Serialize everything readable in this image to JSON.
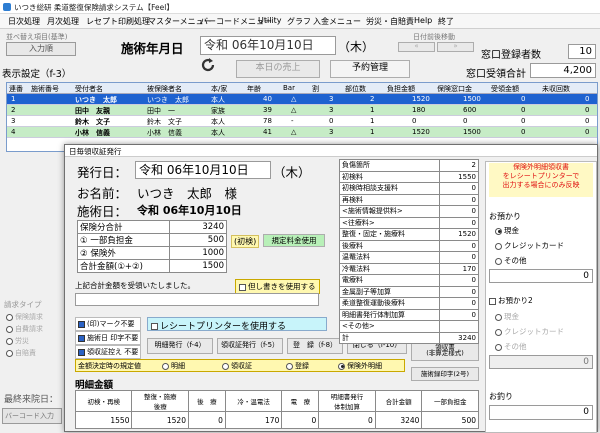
{
  "window": {
    "title": "いつき総研 柔道整復保険請求システム【Feel】"
  },
  "menu": [
    "日次処理",
    "月次処理",
    "レセプト印刷処理",
    "マスターメニュー",
    "バーコードメニュー",
    "Utility",
    "グラフ",
    "入金メニュー",
    "労災・自賠責",
    "Help",
    "終了"
  ],
  "main": {
    "sort_label": "並べ替え項目(基準)",
    "sort_value": "入力順",
    "date_label": "施術年月日",
    "date_value": "令和 06年10月10日",
    "weekday": "（木）",
    "display_setting": "表示設定（f-3）",
    "today_sales": "本日の売上",
    "reservation": "予約管理",
    "day_move_label": "日付前後移動",
    "counter_label": "窓口登録者数",
    "counter_value": "10",
    "window_total_label": "窓口受領合計",
    "window_total_value": "4,200",
    "reception_type_label": "請求タイプ",
    "reception_options": [
      "保険請求",
      "自費請求",
      "労災",
      "自賠責"
    ],
    "last_visit_label": "最終来院日：",
    "barcode_label": "バーコード入力"
  },
  "grid": {
    "headers": [
      "連番",
      "施術番号",
      "受付者名",
      "被保険者名",
      "本/家",
      "年齢",
      "Bar",
      "割",
      "部位数",
      "負担金額",
      "保険窓口金",
      "受領金額",
      "未収回数"
    ],
    "rows": [
      {
        "no": "1",
        "sid": "",
        "name": "いつき　太郎",
        "ins": "いつき　太郎",
        "type": "本人",
        "age": "40",
        "bar": "△",
        "wari": "3",
        "parts": "2",
        "burden": "1520",
        "window": "1500",
        "recv": "0",
        "uncol": "0"
      },
      {
        "no": "2",
        "sid": "",
        "name": "田中　友親",
        "ins": "田中　一",
        "type": "家族",
        "age": "39",
        "bar": "△",
        "wari": "3",
        "parts": "1",
        "burden": "180",
        "window": "600",
        "recv": "0",
        "uncol": "0"
      },
      {
        "no": "3",
        "sid": "",
        "name": "鈴木　文子",
        "ins": "鈴木　文子",
        "type": "本人",
        "age": "78",
        "bar": "-",
        "wari": "0",
        "parts": "1",
        "burden": "0",
        "window": "0",
        "recv": "0",
        "uncol": "0"
      },
      {
        "no": "4",
        "sid": "",
        "name": "小林　信義",
        "ins": "小林　信義",
        "type": "本人",
        "age": "41",
        "bar": "△",
        "wari": "3",
        "parts": "1",
        "burden": "1520",
        "window": "1500",
        "recv": "0",
        "uncol": "0"
      }
    ]
  },
  "dialog": {
    "title": "日毎領収証発行",
    "issue_label": "発行日：",
    "issue_date": "令和 06年10月10日",
    "issue_weekday": "（木）",
    "name_label": "お名前：",
    "name_value": "いつき　太郎　様",
    "treat_label": "施術日：",
    "treat_date": "令和 06年10月10日",
    "summary": [
      {
        "label": "保険分合計",
        "value": "3240",
        "tag": ""
      },
      {
        "label": "① 一部負担金",
        "value": "500",
        "tag": "(初検)"
      },
      {
        "label": "② 保険外",
        "value": "1000",
        "tag": ""
      },
      {
        "label": "合計金額(①+②)",
        "value": "1500",
        "tag": ""
      }
    ],
    "standard_button": "規定料金使用",
    "received_text": "上記合計金額を受領いたしました。",
    "proviso_label": "但し書きを使用する",
    "checks": [
      {
        "label": "(印)マーク不要",
        "on": true
      },
      {
        "label": "施術日 印字不要",
        "on": true
      },
      {
        "label": "領収証控え 不要",
        "on": true
      }
    ],
    "printer_label": "レシートプリンターを使用する",
    "buttons": {
      "detail": "明細発行（f-4）",
      "receipt": "領収証発行（f-5）",
      "register": "登　録（f-8）",
      "close": "閉じる（f-10）",
      "issue_receipt": "保険外明細\n領収書\n(非算定様式)",
      "treatment_print": "施術録印字(2号)"
    },
    "radio_label": "金額決定時の規定値",
    "radios": [
      {
        "label": "明細",
        "on": false
      },
      {
        "label": "領収証",
        "on": false
      },
      {
        "label": "登録",
        "on": false
      },
      {
        "label": "保険外明細",
        "on": true
      }
    ],
    "detail_heading": "明細金額",
    "detail_headers": [
      "初検・再検",
      "整復・施療\n後療",
      "後　療",
      "冷・温電法",
      "電　療",
      "明細書発行\n体制加算",
      "合計金額",
      "一部負担金"
    ],
    "detail_values": [
      "1550",
      "1520",
      "0",
      "170",
      "0",
      "0",
      "3240",
      "500"
    ],
    "fee_items": [
      {
        "label": "負傷箇所",
        "value": "2"
      },
      {
        "label": "初検料",
        "value": "1550"
      },
      {
        "label": "初検時相談支援料",
        "value": "0"
      },
      {
        "label": "再検料",
        "value": "0"
      },
      {
        "label": "<施術情報提供料>",
        "value": "0"
      },
      {
        "label": "<往療料>",
        "value": "0"
      },
      {
        "label": "整復・固定・施療料",
        "value": "1520"
      },
      {
        "label": "後療料",
        "value": "0"
      },
      {
        "label": "温罨法料",
        "value": "0"
      },
      {
        "label": "冷罨法料",
        "value": "170"
      },
      {
        "label": "電療料",
        "value": "0"
      },
      {
        "label": "金属副子等加算",
        "value": "0"
      },
      {
        "label": "柔道整復運動後療料",
        "value": "0"
      },
      {
        "label": "明細書発行体制加算",
        "value": "0"
      },
      {
        "label": "<その他>",
        "value": ""
      },
      {
        "label": "計",
        "value": "3240"
      }
    ],
    "notice": "保険外明細領収書\nをレシートプリンターで\n出力する場合にのみ反映",
    "deposit_label": "お預かり",
    "deposit_options": [
      {
        "label": "現金",
        "on": true
      },
      {
        "label": "クレジットカード",
        "on": false
      },
      {
        "label": "その他",
        "on": false
      }
    ],
    "deposit_value": "0",
    "deposit2_label": "お預かり2",
    "deposit2_options": [
      "現金",
      "クレジットカード",
      "その他"
    ],
    "deposit2_value": "0",
    "change_label": "お釣り",
    "change_value": "0"
  },
  "colors": {
    "highlight": "#c6ecc6",
    "selected": "#1e62d0",
    "notice_text": "#e01010",
    "notice_bg": "#fff9c4"
  }
}
